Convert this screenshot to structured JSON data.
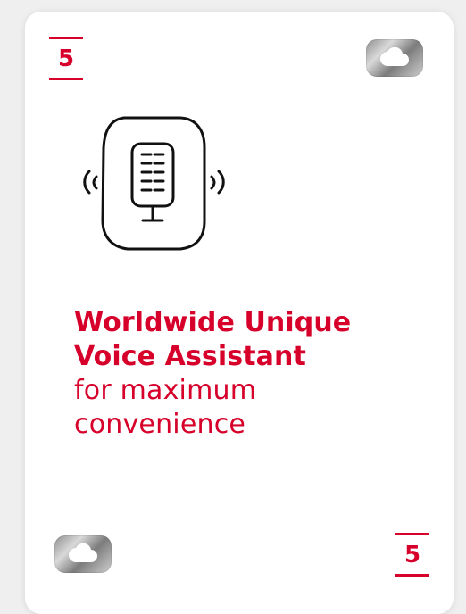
{
  "card": {
    "number_top": "5",
    "number_bottom": "5",
    "headline_line1": "Worldwide Unique",
    "headline_line2": "Voice Assistant",
    "subline1": "for maximum",
    "subline2": "convenience"
  },
  "icons": {
    "cloud": "cloud-icon",
    "microphone": "voice-assistant-icon"
  },
  "colors": {
    "accent": "#d6002a",
    "badge_dark": "#7c7c7c",
    "badge_light": "#d9d9d9"
  }
}
